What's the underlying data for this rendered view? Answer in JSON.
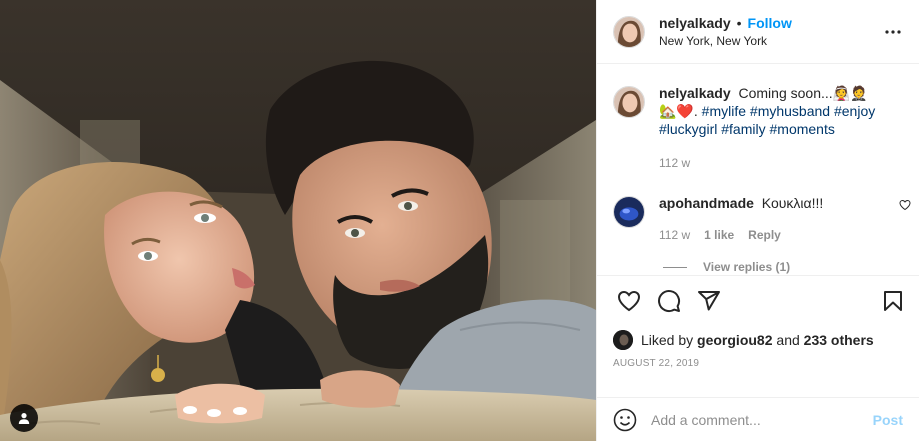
{
  "post": {
    "username": "nelyalkady",
    "separator": "•",
    "follow_label": "Follow",
    "location": "New York, New York"
  },
  "caption": {
    "username": "nelyalkady",
    "text": "Coming soon...",
    "emoji": "👰🤵🏡❤️.",
    "hashtags": [
      "#mylife",
      "#myhusband",
      "#enjoy",
      "#luckygirl",
      "#family",
      "#moments"
    ],
    "time": "112 w"
  },
  "comment": {
    "username": "apohandmade",
    "text": "Κουκλια!!!",
    "time": "112 w",
    "likes": "1 like",
    "reply_label": "Reply",
    "view_replies": "View replies (1)"
  },
  "likes": {
    "prefix": "Liked by",
    "user": "georgiou82",
    "suffix": "and",
    "others": "233 others"
  },
  "date": "AUGUST 22, 2019",
  "add_comment": {
    "placeholder": "Add a comment...",
    "post_label": "Post"
  },
  "icons": {
    "like": "heart-icon",
    "comment": "comment-icon",
    "share": "share-icon",
    "save": "bookmark-icon",
    "more": "more-options-icon",
    "emoji": "emoji-icon",
    "tag": "user-tag-icon"
  },
  "colors": {
    "accent": "#0095f6",
    "hashtag": "#00376b",
    "muted": "#8e8e8e",
    "border": "#efefef"
  }
}
